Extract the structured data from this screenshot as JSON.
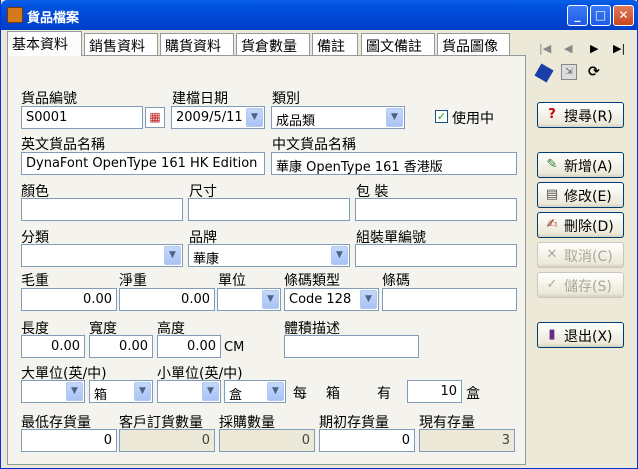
{
  "window": {
    "title": "貨品檔案",
    "min": "_",
    "max": "□",
    "close": "✕"
  },
  "tabs": [
    "基本資料",
    "銷售資料",
    "購貨資料",
    "貨倉數量",
    "備註",
    "圖文備註",
    "貨品圖像"
  ],
  "form": {
    "code_label": "貨品編號",
    "code_value": "S0001",
    "date_label": "建檔日期",
    "date_value": "2009/5/11",
    "category_label": "類別",
    "category_value": "成品類",
    "inuse_label": "使用中",
    "en_name_label": "英文貨品名稱",
    "en_name_value": "DynaFont OpenType 161 HK Edition",
    "zh_name_label": "中文貨品名稱",
    "zh_name_value": "華康 OpenType 161 香港版",
    "color_label": "顏色",
    "size_label": "尺寸",
    "pack_label": "包 裝",
    "class_label": "分類",
    "brand_label": "品牌",
    "brand_value": "華康",
    "assembly_label": "組裝單編號",
    "gross_label": "毛重",
    "gross_value": "0.00",
    "net_label": "淨重",
    "net_value": "0.00",
    "unit_label": "單位",
    "barcode_type_label": "條碼類型",
    "barcode_type_value": "Code 128",
    "barcode_label": "條碼",
    "length_label": "長度",
    "length_value": "0.00",
    "width_label": "寬度",
    "width_value": "0.00",
    "height_label": "高度",
    "height_value": "0.00",
    "cm": "CM",
    "volume_label": "體積描述",
    "big_unit_label": "大單位(英/中)",
    "big_unit_value": "箱",
    "small_unit_label": "小單位(英/中)",
    "small_unit_value": "盒",
    "per_label": "每",
    "box_label": "箱",
    "have_label": "有",
    "qty_value": "10",
    "box2_label": "盒",
    "min_stock_label": "最低存貨量",
    "min_stock_value": "0",
    "cust_order_label": "客戶訂貨數量",
    "cust_order_value": "0",
    "purchase_label": "採購數量",
    "purchase_value": "0",
    "initial_label": "期初存貨量",
    "initial_value": "0",
    "current_label": "現有存量",
    "current_value": "3"
  },
  "buttons": {
    "search": "搜尋(R)",
    "add": "新增(A)",
    "edit": "修改(E)",
    "delete": "刪除(D)",
    "cancel": "取消(C)",
    "save": "儲存(S)",
    "exit": "退出(X)"
  },
  "nav": {
    "first": "|◀",
    "prev": "◀",
    "next": "▶",
    "last": "▶|"
  }
}
